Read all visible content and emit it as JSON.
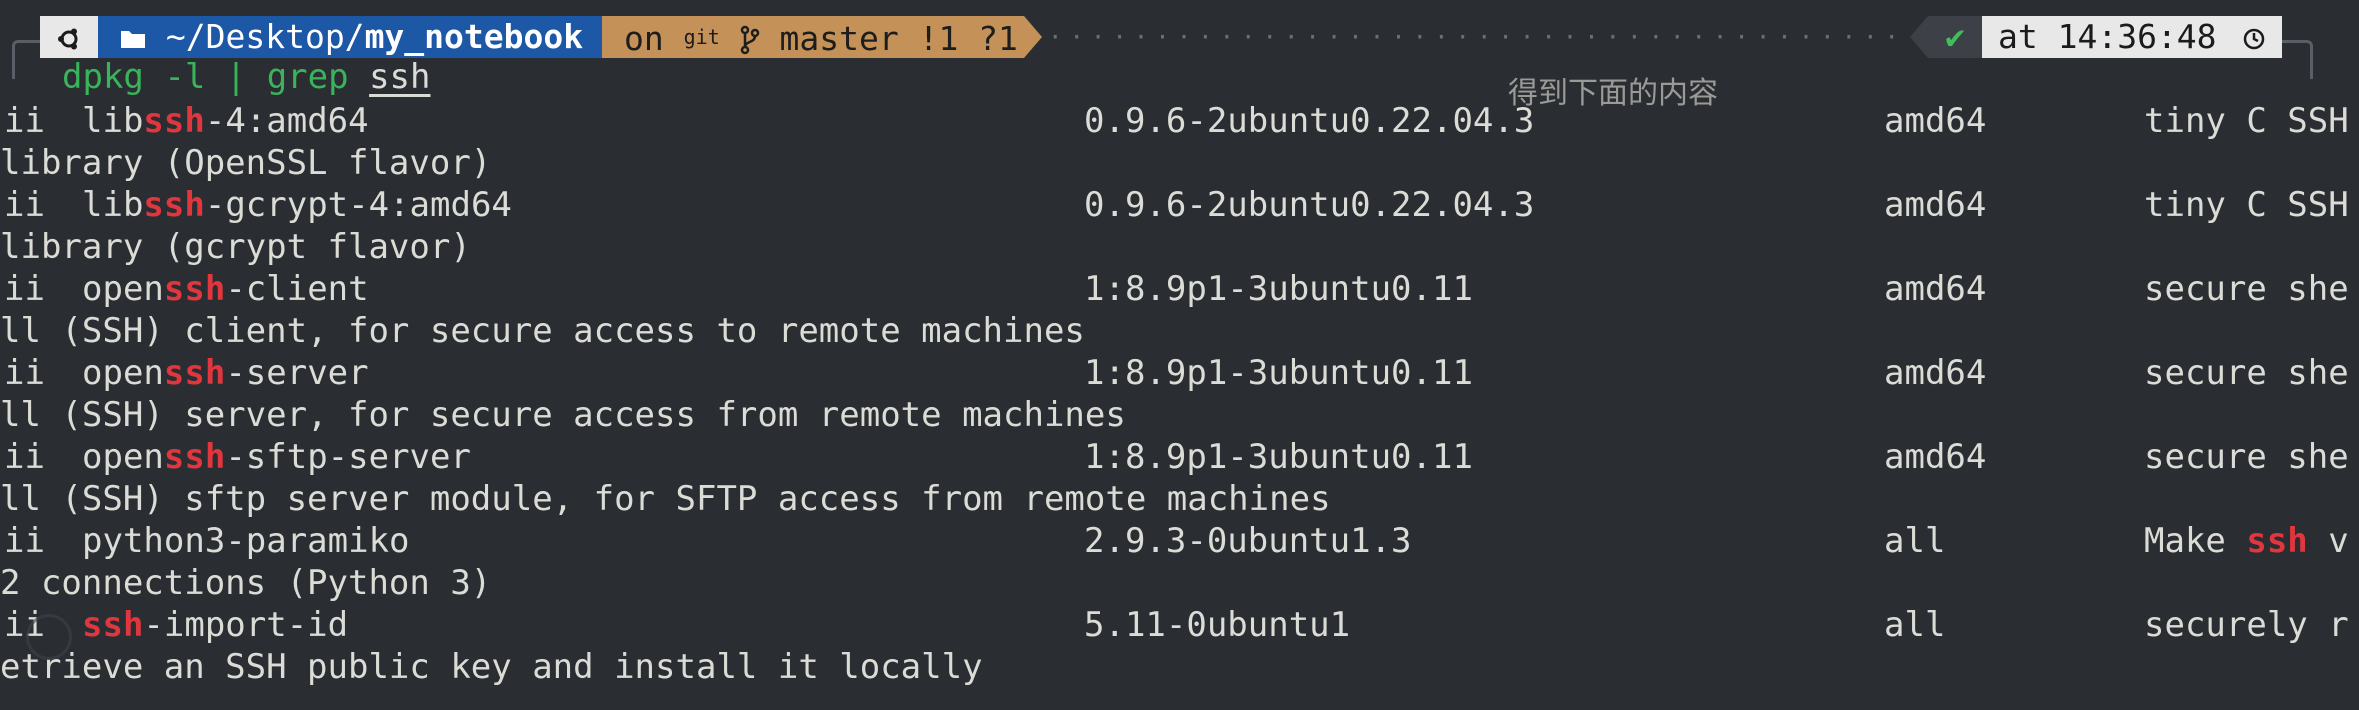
{
  "prompt": {
    "os_icon": "ubuntu-icon",
    "folder_icon": "folder-icon",
    "dir_prefix": "~/Desktop/",
    "dir_bold": "my_notebook",
    "git_on": "on",
    "git_word": "git",
    "branch_icon": "branch-icon",
    "branch": "master !1 ?1",
    "status_check": "✔",
    "time_text": "at 14:36:48",
    "clock_icon": "clock-icon"
  },
  "command": {
    "cmd_pre": "dpkg -l | ",
    "cmd_grep": "grep",
    "cmd_arg": "ssh"
  },
  "annotation": "得到下面的内容",
  "rows": [
    {
      "status": "ii",
      "name_pre": "lib",
      "name_hl": "ssh",
      "name_post": "-4:amd64",
      "version": "0.9.6-2ubuntu0.22.04.3",
      "arch": "amd64",
      "desc1_pre": "tiny C SSH",
      "desc1_hl": "",
      "desc1_post": "",
      "desc2": " library (OpenSSL flavor)"
    },
    {
      "status": "ii",
      "name_pre": "lib",
      "name_hl": "ssh",
      "name_post": "-gcrypt-4:amd64",
      "version": "0.9.6-2ubuntu0.22.04.3",
      "arch": "amd64",
      "desc1_pre": "tiny C SSH",
      "desc1_hl": "",
      "desc1_post": "",
      "desc2": " library (gcrypt flavor)"
    },
    {
      "status": "ii",
      "name_pre": "open",
      "name_hl": "ssh",
      "name_post": "-client",
      "version": "1:8.9p1-3ubuntu0.11",
      "arch": "amd64",
      "desc1_pre": "secure she",
      "desc1_hl": "",
      "desc1_post": "",
      "desc2": "ll (SSH) client, for secure access to remote machines"
    },
    {
      "status": "ii",
      "name_pre": "open",
      "name_hl": "ssh",
      "name_post": "-server",
      "version": "1:8.9p1-3ubuntu0.11",
      "arch": "amd64",
      "desc1_pre": "secure she",
      "desc1_hl": "",
      "desc1_post": "",
      "desc2": "ll (SSH) server, for secure access from remote machines"
    },
    {
      "status": "ii",
      "name_pre": "open",
      "name_hl": "ssh",
      "name_post": "-sftp-server",
      "version": "1:8.9p1-3ubuntu0.11",
      "arch": "amd64",
      "desc1_pre": "secure she",
      "desc1_hl": "",
      "desc1_post": "",
      "desc2": "ll (SSH) sftp server module, for SFTP access from remote machines"
    },
    {
      "status": "ii",
      "name_pre": "python3-paramiko",
      "name_hl": "",
      "name_post": "",
      "version": "2.9.3-0ubuntu1.3",
      "arch": "all",
      "desc1_pre": "Make ",
      "desc1_hl": "ssh",
      "desc1_post": " v",
      "desc2": "2 connections (Python 3)"
    },
    {
      "status": "ii",
      "name_pre": "",
      "name_hl": "ssh",
      "name_post": "-import-id",
      "version": "5.11-0ubuntu1",
      "arch": "all",
      "desc1_pre": "securely r",
      "desc1_hl": "",
      "desc1_post": "",
      "desc2": "etrieve an SSH public key and install it locally"
    }
  ],
  "colors": {
    "background": "#2a2d32",
    "dir_segment": "#1c58a6",
    "git_segment": "#c49158",
    "highlight": "#e0363e",
    "command_green": "#39b45a"
  }
}
